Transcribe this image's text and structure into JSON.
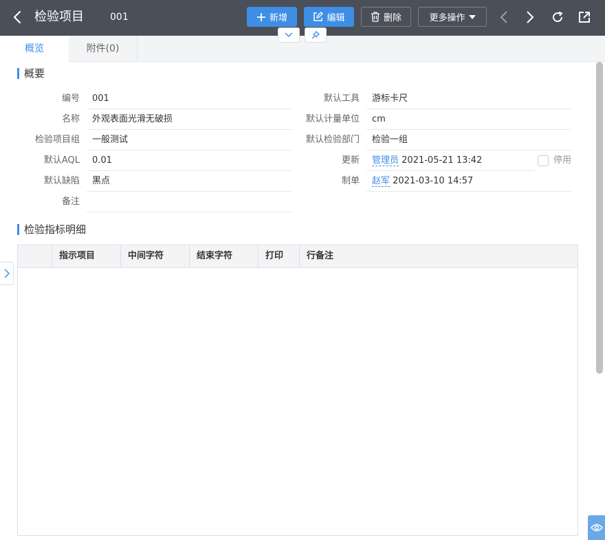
{
  "header": {
    "title": "检验项目",
    "code": "001",
    "buttons": {
      "add": "新增",
      "edit": "编辑",
      "delete": "删除",
      "more": "更多操作"
    }
  },
  "tabs": [
    {
      "label": "概览"
    },
    {
      "label": "附件(0)"
    }
  ],
  "summary": {
    "section_title": "概要",
    "left": [
      {
        "label": "编号",
        "value": "001"
      },
      {
        "label": "名称",
        "value": "外观表面光滑无破损"
      },
      {
        "label": "检验项目组",
        "value": "一般测试"
      },
      {
        "label": "默认AQL",
        "value": "0.01"
      },
      {
        "label": "默认缺陷",
        "value": "黑点"
      },
      {
        "label": "备注",
        "value": ""
      }
    ],
    "right": [
      {
        "label": "默认工具",
        "value": "游标卡尺"
      },
      {
        "label": "默认计量单位",
        "value": "cm"
      },
      {
        "label": "默认检验部门",
        "value": "检验一组"
      }
    ],
    "updated": {
      "label": "更新",
      "user": "管理员",
      "time": "2021-05-21 13:42"
    },
    "created": {
      "label": "制单",
      "user": "赵军",
      "time": "2021-03-10 14:57"
    },
    "disabled_label": "停用"
  },
  "detail": {
    "section_title": "检验指标明细",
    "columns": [
      "指示项目",
      "中间字符",
      "结束字符",
      "打印",
      "行备注"
    ]
  },
  "colors": {
    "header_bg": "#4a4f58",
    "accent": "#3e8ee6"
  }
}
